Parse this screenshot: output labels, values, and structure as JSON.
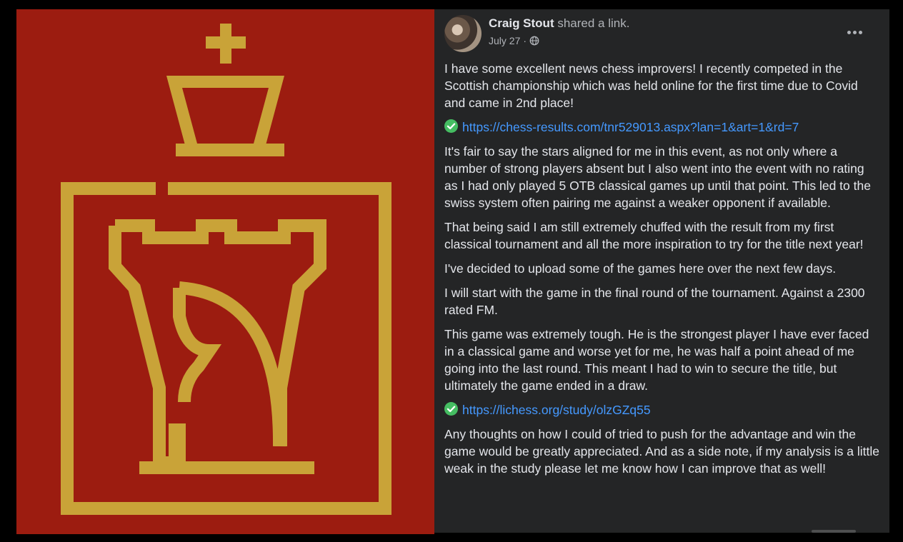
{
  "colors": {
    "image_background": "#9c1c10",
    "gold": "#c9a338",
    "post_background": "#242526",
    "text_primary": "#e4e6eb",
    "text_secondary": "#b0b3b8",
    "link": "#4599ff",
    "check": "#45bd62"
  },
  "image": {
    "subject": "gold king-rook-knight chess emblem logo"
  },
  "post": {
    "author": "Craig Stout",
    "action": " shared a link.",
    "date": "July 27",
    "date_separator": " · ",
    "privacy_icon": "globe-icon",
    "more_icon": "more-options-icon",
    "blocks": [
      {
        "type": "text",
        "text": "I have some excellent news chess improvers! I recently competed in the Scottish championship which was held online for the first time due to Covid and came in 2nd place!"
      },
      {
        "type": "link",
        "icon": "check-mark-icon",
        "text": "https://chess-results.com/tnr529013.aspx?lan=1&art=1&rd=7"
      },
      {
        "type": "text",
        "text": "It's fair to say the stars aligned for me in this event, as not only where a number of strong players absent but I also went into the event with no rating as I had only played 5 OTB classical games up until that point. This led to the swiss system often pairing me against a weaker opponent if available."
      },
      {
        "type": "text",
        "text": "That being said I am still extremely chuffed with the result from my first classical tournament and all the more inspiration to try for the title next year!"
      },
      {
        "type": "text",
        "text": "I've decided to upload some of the games here over the next few days."
      },
      {
        "type": "text",
        "text": "I will start with the game in the final round of the tournament. Against a 2300 rated FM."
      },
      {
        "type": "text",
        "text": "This game was extremely tough. He is the strongest player I have ever faced in a classical game and worse yet for me, he was half a point ahead of me going into the last round. This meant I had to win to secure the title, but ultimately the game ended in a draw."
      },
      {
        "type": "link",
        "icon": "check-mark-icon",
        "text": "https://lichess.org/study/olzGZq55"
      },
      {
        "type": "text",
        "text": "Any thoughts on how I could of tried to push for the advantage and win the game would be greatly appreciated. And as a side note, if my analysis is a little weak in the study please let me know how I can improve that as well!"
      }
    ]
  }
}
